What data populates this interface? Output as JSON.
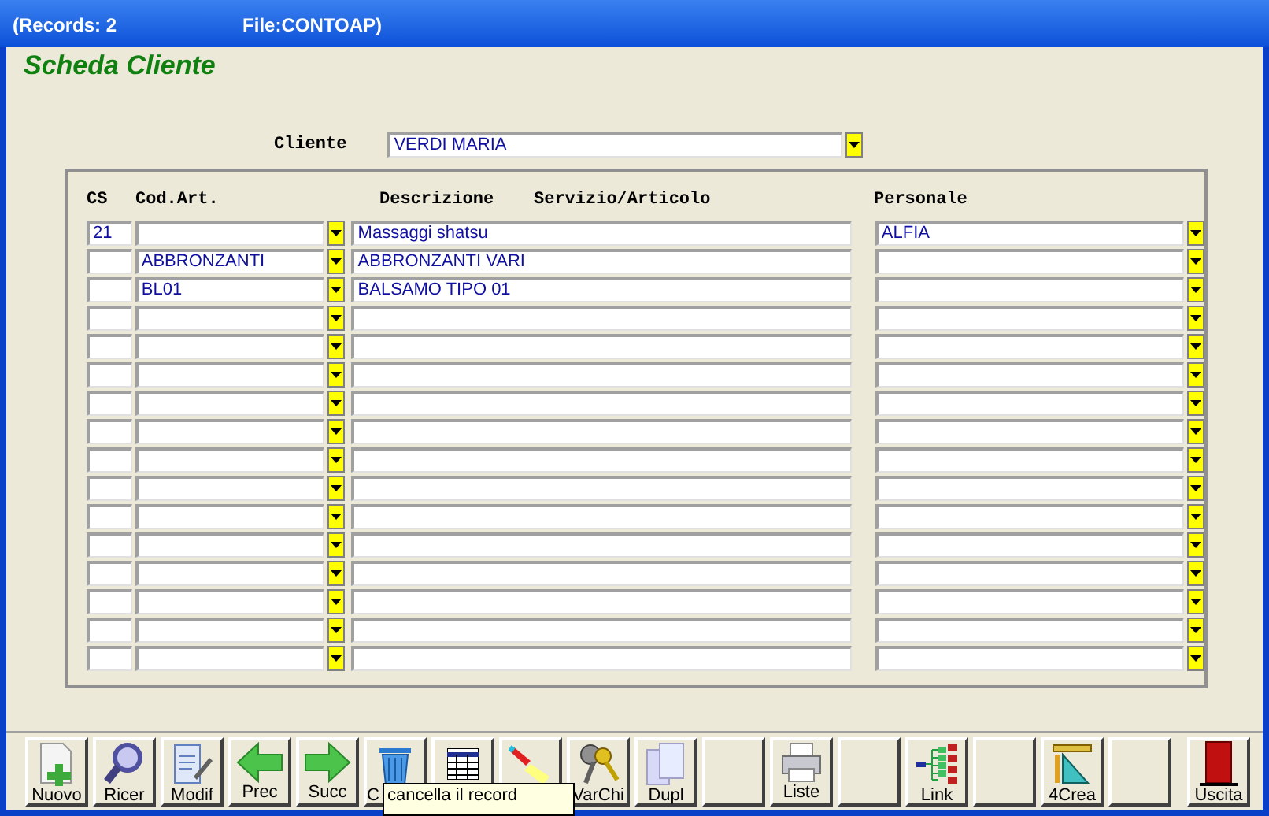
{
  "window": {
    "title_records": "(Records: 2",
    "title_file": "File:CONTOAP)"
  },
  "heading": "Scheda Cliente",
  "cliente": {
    "label": "Cliente",
    "value": "VERDI MARIA"
  },
  "table": {
    "columns": [
      "CS",
      "Cod.Art.",
      "Descrizione",
      "Servizio/Articolo",
      "Personale"
    ],
    "rows": [
      {
        "cs": "21",
        "descrizione": "Massaggi shatsu",
        "personale": "ALFIA"
      },
      {
        "cod": "ABBRONZANTI",
        "descrizione": "ABBRONZANTI VARI"
      },
      {
        "cod": "BL01",
        "descrizione": "BALSAMO TIPO 01"
      },
      {},
      {},
      {},
      {},
      {},
      {},
      {},
      {},
      {},
      {},
      {},
      {},
      {}
    ]
  },
  "toolbar": [
    {
      "kind": "new",
      "label": "Nuovo"
    },
    {
      "kind": "search",
      "label": "Ricer"
    },
    {
      "kind": "edit",
      "label": "Modif"
    },
    {
      "kind": "prev",
      "label": "Prec"
    },
    {
      "kind": "next",
      "label": "Succ"
    },
    {
      "kind": "trash",
      "label": "C"
    },
    {
      "kind": "table"
    },
    {
      "kind": "torch"
    },
    {
      "kind": "keys",
      "label": "VarChi"
    },
    {
      "kind": "copy",
      "label": "Dupl"
    },
    {
      "kind": "blank"
    },
    {
      "kind": "print",
      "label": "Liste"
    },
    {
      "kind": "blank"
    },
    {
      "kind": "tree",
      "label": "Link"
    },
    {
      "kind": "blank"
    },
    {
      "kind": "ruler",
      "label": "4Crea"
    },
    {
      "kind": "blank"
    },
    {
      "kind": "exit",
      "label": "Uscita"
    }
  ],
  "tooltip": "cancella il record"
}
